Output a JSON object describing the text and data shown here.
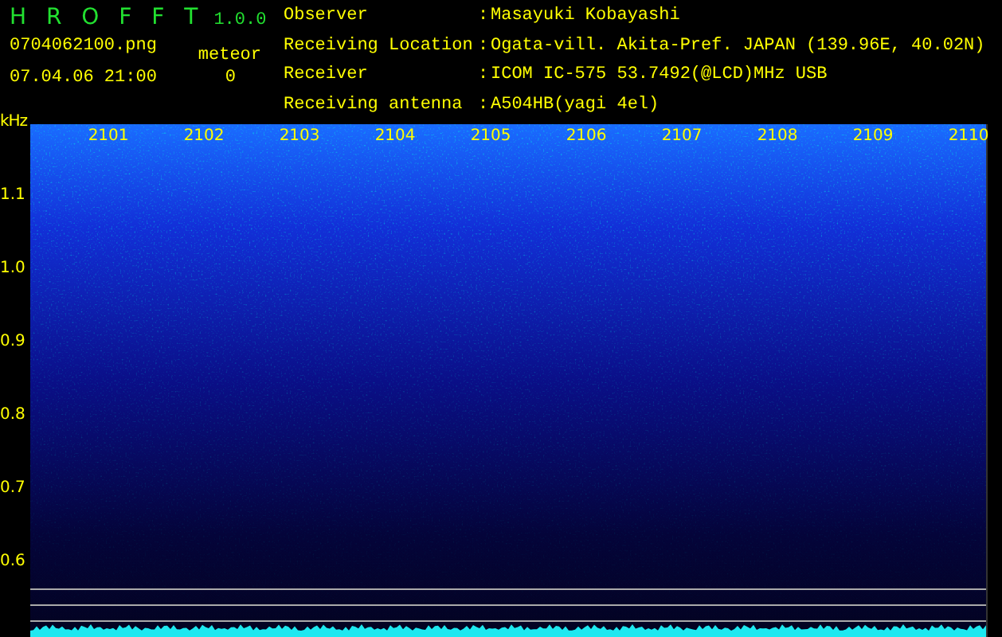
{
  "app": {
    "name": "H R O F F T",
    "version": "1.0.0",
    "file": "0704062100.png",
    "datetime": "07.04.06 21:00",
    "meteor_label": "meteor",
    "meteor_count": "0"
  },
  "station": [
    {
      "label": "Observer",
      "sep": ":",
      "value": "Masayuki Kobayashi"
    },
    {
      "label": "Receiving Location",
      "sep": ":",
      "value": "Ogata-vill. Akita-Pref. JAPAN (139.96E, 40.02N)"
    },
    {
      "label": "Receiver",
      "sep": ":",
      "value": "ICOM IC-575 53.7492(@LCD)MHz USB"
    },
    {
      "label": "Receiving antenna",
      "sep": ":",
      "value": "A504HB(yagi 4el)"
    }
  ],
  "frequency_axis": {
    "unit": "kHz",
    "labels": [
      "1.1",
      "1.0",
      "0.9",
      "0.8",
      "0.7",
      "0.6"
    ]
  },
  "minutes": [
    "2101",
    "2102",
    "2103",
    "2104",
    "2105",
    "2106",
    "2107",
    "2108",
    "2109",
    "2110"
  ]
}
